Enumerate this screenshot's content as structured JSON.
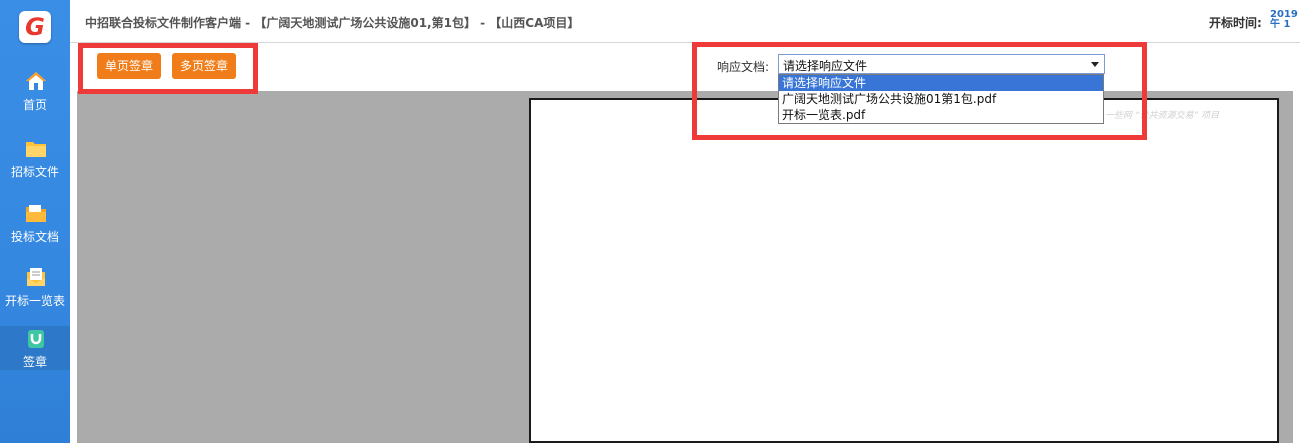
{
  "app": {
    "logo_letter": "G",
    "title": "中招联合投标文件制作客户端 - 【广阔天地测试广场公共设施01,第1包】 - 【山西CA项目】"
  },
  "header": {
    "open_time_label": "开标时间:",
    "open_time_value_line1": "2019",
    "open_time_value_line2": "午 1"
  },
  "sidebar": {
    "items": [
      {
        "label": "首页",
        "icon": "home-icon"
      },
      {
        "label": "招标文件",
        "icon": "folder-icon"
      },
      {
        "label": "投标文档",
        "icon": "folder-open-icon"
      },
      {
        "label": "开标一览表",
        "icon": "envelope-icon"
      },
      {
        "label": "签章",
        "icon": "seal-icon"
      }
    ],
    "active_index": 4
  },
  "toolbar": {
    "single_sign_label": "单页签章",
    "multi_sign_label": "多页签章"
  },
  "response_doc": {
    "label": "响应文档:",
    "selected": "请选择响应文件",
    "options": [
      "请选择响应文件",
      "广阔天地测试广场公共设施01第1包.pdf",
      "开标一览表.pdf"
    ]
  },
  "document": {
    "watermark": "一些网 “公共资源交易” 项目"
  },
  "colors": {
    "sidebar_blue": "#3588e0",
    "button_orange": "#f07d1a",
    "highlight_red": "#ef3a3a",
    "selected_option": "#3875d7"
  }
}
